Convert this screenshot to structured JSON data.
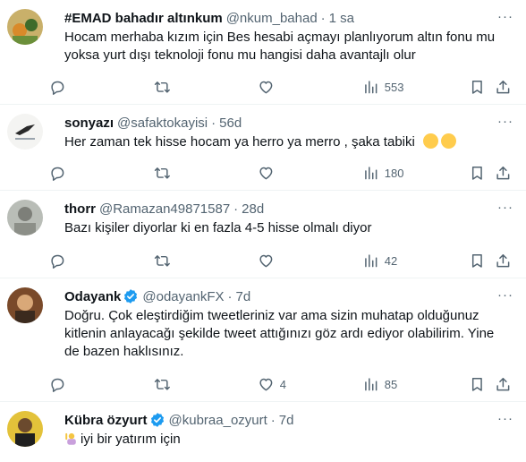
{
  "tweets": [
    {
      "name": "#EMAD bahadır altınkum",
      "handle": "@nkum_bahad",
      "time": "1 sa",
      "text": "Hocam merhaba kızım için Bes hesabi açmayı planlıyorum altın fonu mu yoksa yurt dışı teknoloji fonu mu hangisi daha avantajlı olur",
      "reply_count": "",
      "retweet_count": "",
      "like_count": "",
      "view_count": "553",
      "verified": false
    },
    {
      "name": "sonyazı",
      "handle": "@safaktokayisi",
      "time": "56d",
      "text": "Her zaman tek hisse hocam ya herro ya merro , şaka tabiki",
      "emoji": [
        "smiling-face-with-sweat-icon",
        "smiling-face-with-sweat-icon"
      ],
      "reply_count": "",
      "retweet_count": "",
      "like_count": "",
      "view_count": "180",
      "verified": false
    },
    {
      "name": "thorr",
      "handle": "@Ramazan49871587",
      "time": "28d",
      "text": "Bazı kişiler diyorlar ki en fazla 4-5 hisse olmalı diyor",
      "reply_count": "",
      "retweet_count": "",
      "like_count": "",
      "view_count": "42",
      "verified": false
    },
    {
      "name": "Odayank",
      "handle": "@odayankFX",
      "time": "7d",
      "text": "Doğru. Çok eleştirdiğim tweetleriniz var ama sizin muhatap olduğunuz kitlenin anlayacağı şekilde tweet attığınızı göz ardı ediyor olabilirim. Yine de bazen haklısınız.",
      "reply_count": "",
      "retweet_count": "",
      "like_count": "4",
      "view_count": "85",
      "verified": true
    },
    {
      "name": "Kübra özyurt",
      "handle": "@kubraa_ozyurt",
      "time": "7d",
      "text": "iyi bir yatırım için",
      "emoji_prefix": "person-raising-hand-icon",
      "verified": true
    }
  ],
  "colors": {
    "text": "#0f1419",
    "secondary": "#536471",
    "verified": "#1d9bf0",
    "divider": "#eff3f4"
  }
}
